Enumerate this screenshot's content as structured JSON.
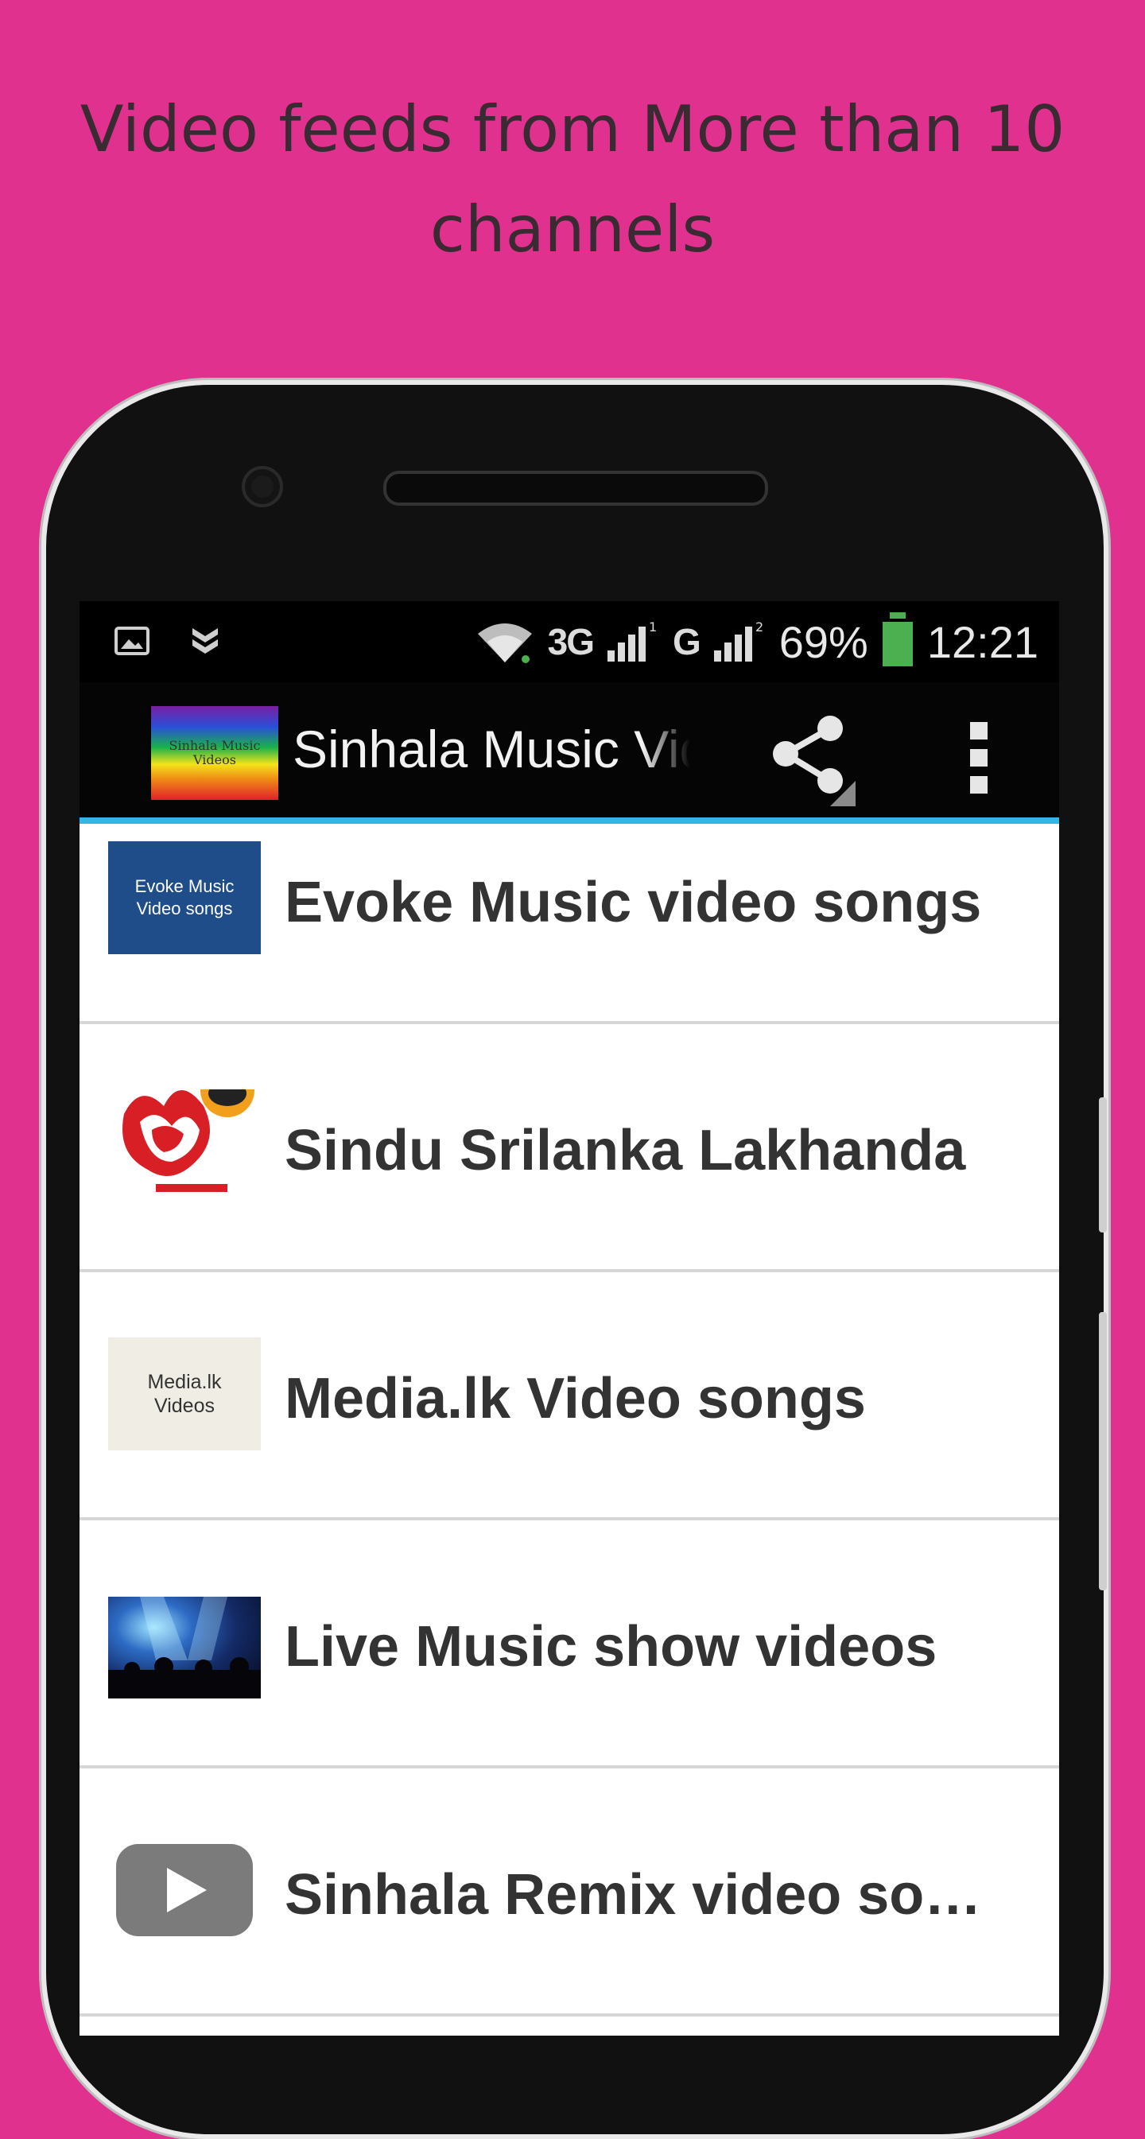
{
  "headline": "Video feeds from More than 10 channels",
  "status_bar": {
    "network_1": "3G",
    "network_2": "G",
    "battery": "69%",
    "time": "12:21"
  },
  "action_bar": {
    "app_title": "Sinhala Music Videos",
    "logo_text": "Sinhala Music Videos"
  },
  "channels": [
    {
      "label": "Evoke Music video songs",
      "thumb_text": "Evoke Music Video songs"
    },
    {
      "label": "Sindu Srilanka Lakhanda",
      "thumb_text": ""
    },
    {
      "label": "Media.lk Video songs",
      "thumb_text": "Media.lk Videos"
    },
    {
      "label": "Live Music show videos",
      "thumb_text": ""
    },
    {
      "label": "Sinhala Remix video songs",
      "thumb_text": ""
    }
  ],
  "colors": {
    "background": "#E0318E",
    "accent_line": "#33b5e5",
    "battery": "#4caf50"
  }
}
